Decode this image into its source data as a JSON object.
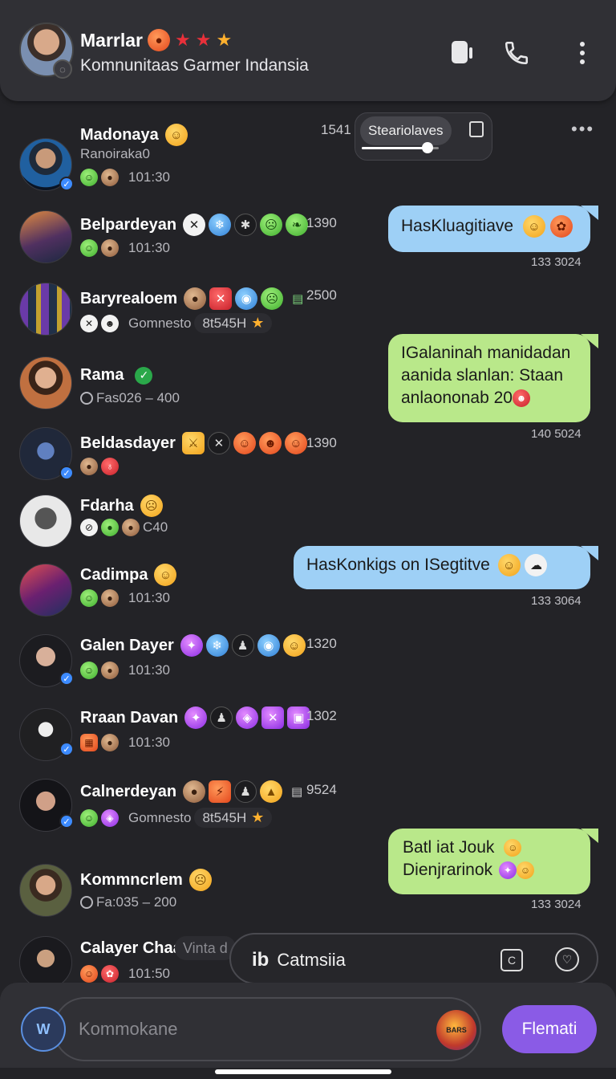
{
  "header": {
    "name": "Marrlar",
    "subtitle": "Komnunitaas Garmer Indansia",
    "icons": [
      "video-icon",
      "phone-icon",
      "more-vert-icon"
    ]
  },
  "popup": {
    "label": "Steariolaves",
    "volume": 0.85
  },
  "chats": [
    {
      "name": "Madonaya",
      "meta": "Ranoiraka0",
      "time": "101:30",
      "count": "1541",
      "more": "•••"
    },
    {
      "name": "Belpardeyan",
      "time": "101:30",
      "count": "1390"
    },
    {
      "name": "Baryrealoem",
      "meta": "Gomnesto",
      "pill": "8t545H",
      "count": "2500"
    },
    {
      "name": "Rama",
      "meta": "Fas026 – 400"
    },
    {
      "name": "Beldasdayer",
      "count": "1390"
    },
    {
      "name": "Fdarha",
      "meta": "C40"
    },
    {
      "name": "Cadimpa",
      "time": "101:30"
    },
    {
      "name": "Galen Dayer",
      "time": "101:30",
      "count": "1320"
    },
    {
      "name": "Rraan Davan",
      "time": "101:30",
      "count": "1302"
    },
    {
      "name": "Calnerdeyan",
      "meta": "Gomnesto",
      "pill": "8t545H",
      "count": "9524"
    },
    {
      "name": "Kommncrlem",
      "meta": "Fa:035 – 200"
    },
    {
      "name": "Calayer Chaa",
      "time": "101:50",
      "chip": "Vinta d"
    }
  ],
  "bubbles": [
    {
      "text": "HasKluagitiave",
      "time": "133 3024",
      "color": "blue"
    },
    {
      "lines": [
        "IGalaninah manidadan",
        "aanida slanlan: Staan",
        "anlaononab 20"
      ],
      "time": "140 5024",
      "color": "green"
    },
    {
      "text": "HasKonkigs on ISegtitve",
      "time": "133 3064",
      "color": "blue"
    },
    {
      "lines": [
        "Batl iat Jouk",
        "Dienjrarinok"
      ],
      "time": "133 3024",
      "color": "green"
    }
  ],
  "float_bar": {
    "label": "Catmsiia",
    "prefix": "ib"
  },
  "composer": {
    "placeholder": "Kommokane",
    "sticker_text": "BARS",
    "send_label": "Flemati"
  }
}
